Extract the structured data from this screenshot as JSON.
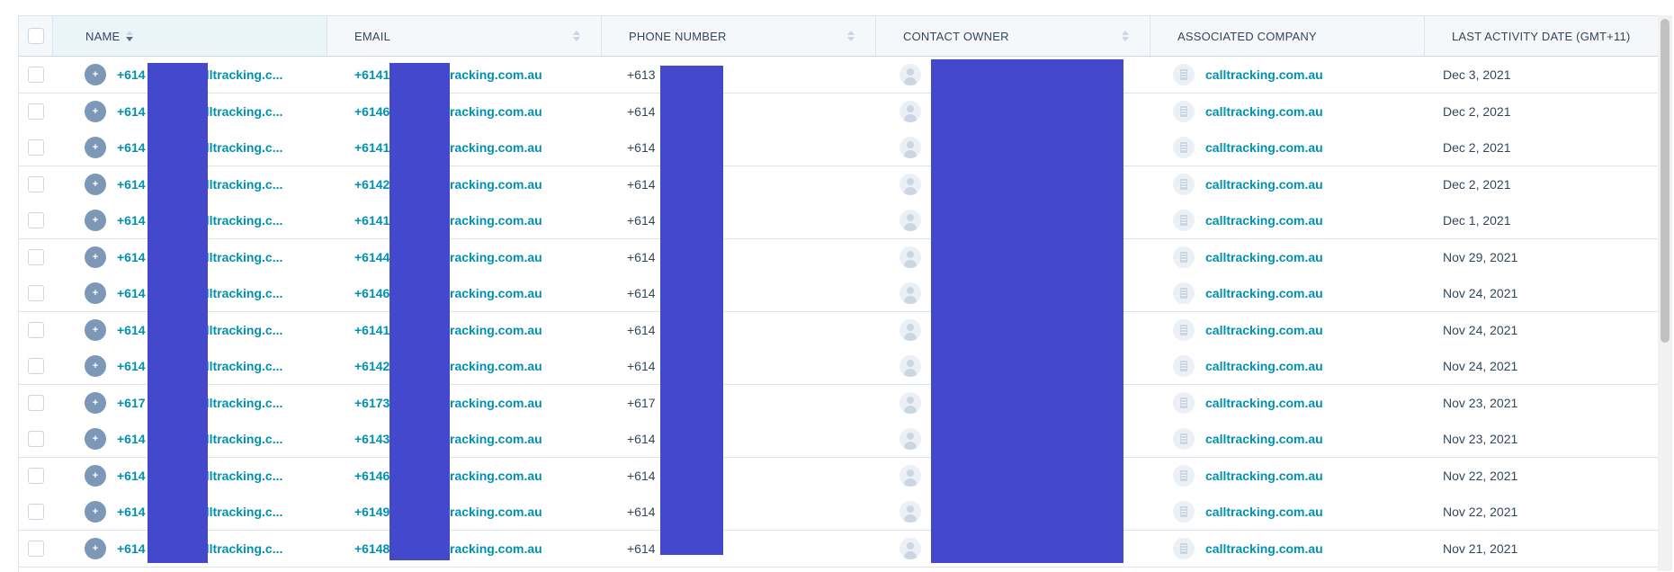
{
  "table": {
    "columns": [
      {
        "key": "name",
        "label": "NAME"
      },
      {
        "key": "email",
        "label": "EMAIL"
      },
      {
        "key": "phone",
        "label": "PHONE NUMBER"
      },
      {
        "key": "owner",
        "label": "CONTACT OWNER"
      },
      {
        "key": "company",
        "label": "ASSOCIATED COMPANY"
      },
      {
        "key": "activity",
        "label": "LAST ACTIVITY DATE (GMT+11)"
      }
    ],
    "rows": [
      {
        "name_prefix": "+614",
        "name_suffix": "@calltracking.c...",
        "email_prefix": "+6141",
        "email_suffix": "@calltracking.com.au",
        "phone": "+613",
        "company": "calltracking.com.au",
        "date": "Dec 3, 2021"
      },
      {
        "name_prefix": "+614",
        "name_suffix": "@calltracking.c...",
        "email_prefix": "+6146",
        "email_suffix": "@calltracking.com.au",
        "phone": "+614",
        "company": "calltracking.com.au",
        "date": "Dec 2, 2021"
      },
      {
        "name_prefix": "+614",
        "name_suffix": "@calltracking.c...",
        "email_prefix": "+6141",
        "email_suffix": "@calltracking.com.au",
        "phone": "+614",
        "company": "calltracking.com.au",
        "date": "Dec 2, 2021"
      },
      {
        "name_prefix": "+614",
        "name_suffix": "@calltracking.c...",
        "email_prefix": "+6142",
        "email_suffix": "@calltracking.com.au",
        "phone": "+614",
        "company": "calltracking.com.au",
        "date": "Dec 2, 2021"
      },
      {
        "name_prefix": "+614",
        "name_suffix": "@calltracking.c...",
        "email_prefix": "+6141",
        "email_suffix": "@calltracking.com.au",
        "phone": "+614",
        "company": "calltracking.com.au",
        "date": "Dec 1, 2021"
      },
      {
        "name_prefix": "+614",
        "name_suffix": "@calltracking.c...",
        "email_prefix": "+6144",
        "email_suffix": "@calltracking.com.au",
        "phone": "+614",
        "company": "calltracking.com.au",
        "date": "Nov 29, 2021"
      },
      {
        "name_prefix": "+614",
        "name_suffix": "@calltracking.c...",
        "email_prefix": "+6146",
        "email_suffix": "@calltracking.com.au",
        "phone": "+614",
        "company": "calltracking.com.au",
        "date": "Nov 24, 2021"
      },
      {
        "name_prefix": "+614",
        "name_suffix": "@calltracking.c...",
        "email_prefix": "+6141",
        "email_suffix": "@calltracking.com.au",
        "phone": "+614",
        "company": "calltracking.com.au",
        "date": "Nov 24, 2021"
      },
      {
        "name_prefix": "+614",
        "name_suffix": "@calltracking.c...",
        "email_prefix": "+6142",
        "email_suffix": "@calltracking.com.au",
        "phone": "+614",
        "company": "calltracking.com.au",
        "date": "Nov 24, 2021"
      },
      {
        "name_prefix": "+617",
        "name_suffix": "@calltracking.c...",
        "email_prefix": "+6173",
        "email_suffix": "@calltracking.com.au",
        "phone": "+617",
        "company": "calltracking.com.au",
        "date": "Nov 23, 2021"
      },
      {
        "name_prefix": "+614",
        "name_suffix": "@calltracking.c...",
        "email_prefix": "+6143",
        "email_suffix": "@calltracking.com.au",
        "phone": "+614",
        "company": "calltracking.com.au",
        "date": "Nov 23, 2021"
      },
      {
        "name_prefix": "+614",
        "name_suffix": "@calltracking.c...",
        "email_prefix": "+6146",
        "email_suffix": "@calltracking.com.au",
        "phone": "+614",
        "company": "calltracking.com.au",
        "date": "Nov 22, 2021"
      },
      {
        "name_prefix": "+614",
        "name_suffix": "@calltracking.c...",
        "email_prefix": "+6149",
        "email_suffix": "@calltracking.com.au",
        "phone": "+614",
        "company": "calltracking.com.au",
        "date": "Nov 22, 2021"
      },
      {
        "name_prefix": "+614",
        "name_suffix": "@calltracking.c...",
        "email_prefix": "+6148",
        "email_suffix": "@calltracking.com.au",
        "phone": "+614",
        "company": "calltracking.com.au",
        "date": "Nov 21, 2021"
      }
    ]
  },
  "icons": {
    "row_avatar": "plus-avatar-icon",
    "owner_avatar": "person-avatar-icon",
    "company_avatar": "building-icon",
    "sort": "sort-icon"
  },
  "colors": {
    "link": "#0091ae",
    "header_bg": "#f5f8fa",
    "active_header_bg": "#eaf5fa",
    "redaction": "#4348cc"
  }
}
